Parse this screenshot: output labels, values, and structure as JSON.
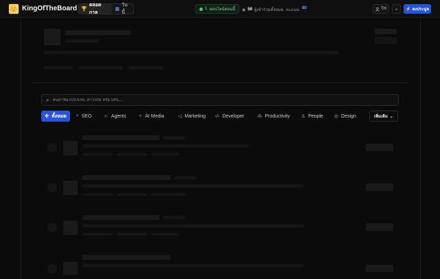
{
  "app": {
    "brand": "KingOfTheBoard",
    "logo_icon": "crown-icon"
  },
  "header": {
    "range_tabs": [
      {
        "label": "ตลอดกาล",
        "icon": "trophy-icon",
        "active": true
      },
      {
        "label": "วันนี้",
        "icon": "calendar-icon",
        "active": false
      }
    ],
    "online": {
      "count": "1",
      "label": "ออนไลน์ตอนนี้"
    },
    "players": {
      "count": "50",
      "label": "ผู้เข้าร่วมทั้งหมด"
    },
    "score": {
      "label": "คะแนน",
      "value": "80"
    },
    "lang": "TH",
    "signup": "ลงประมูล",
    "accent": "#2b55d6"
  },
  "search": {
    "placeholder": "ค้นหาชื่อโปรเจกต์, คำโปรย หรือ URL..."
  },
  "filters": [
    {
      "label": "ทั้งหมด",
      "icon": "grid-icon",
      "active": true
    },
    {
      "label": "SEO",
      "icon": "search-icon"
    },
    {
      "label": "Agents",
      "icon": "bot-icon"
    },
    {
      "label": "AI Media",
      "icon": "sparkle-icon"
    },
    {
      "label": "Marketing",
      "icon": "megaphone-icon"
    },
    {
      "label": "Developer",
      "icon": "code-icon"
    },
    {
      "label": "Productivity",
      "icon": "zap-icon"
    },
    {
      "label": "People",
      "icon": "user-icon"
    },
    {
      "label": "Design",
      "icon": "palette-icon"
    }
  ],
  "more_filter": "เพิ่มเติม"
}
